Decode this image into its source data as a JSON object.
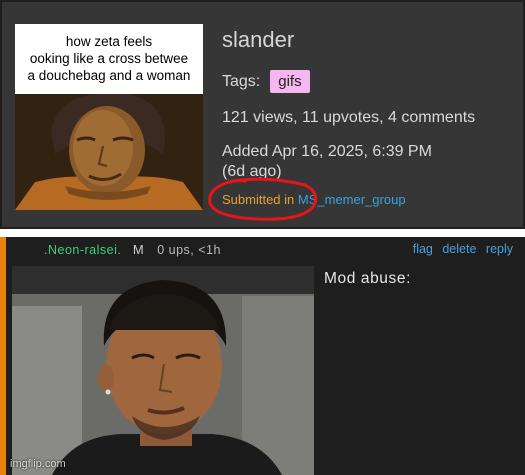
{
  "post": {
    "thumbnail_caption": "how zeta feels\nooking like a cross betwee\na douchebag and a woman",
    "title": "slander",
    "tags_label": "Tags:",
    "tag": "gifs",
    "stats": "121 views, 11 upvotes, 4 comments",
    "added_line1": "Added Apr 16, 2025, 6:39 PM",
    "added_line2": "(6d ago)",
    "submitted_label": "Submitted in",
    "group": "MS_memer_group"
  },
  "comment": {
    "username": ".Neon-ralsei.",
    "mod_badge": "M",
    "meta": "0 ups, <1h",
    "actions": [
      "flag",
      "delete",
      "reply"
    ],
    "text": "Mod abuse:"
  },
  "watermark": "imgflip.com",
  "colors": {
    "tag_bg": "#f4b7f0",
    "username": "#3fd07a",
    "link": "#4a9fe0",
    "submitted": "#e8a030",
    "accent_bar": "#e8820c",
    "highlight_circle": "#e8141b"
  }
}
